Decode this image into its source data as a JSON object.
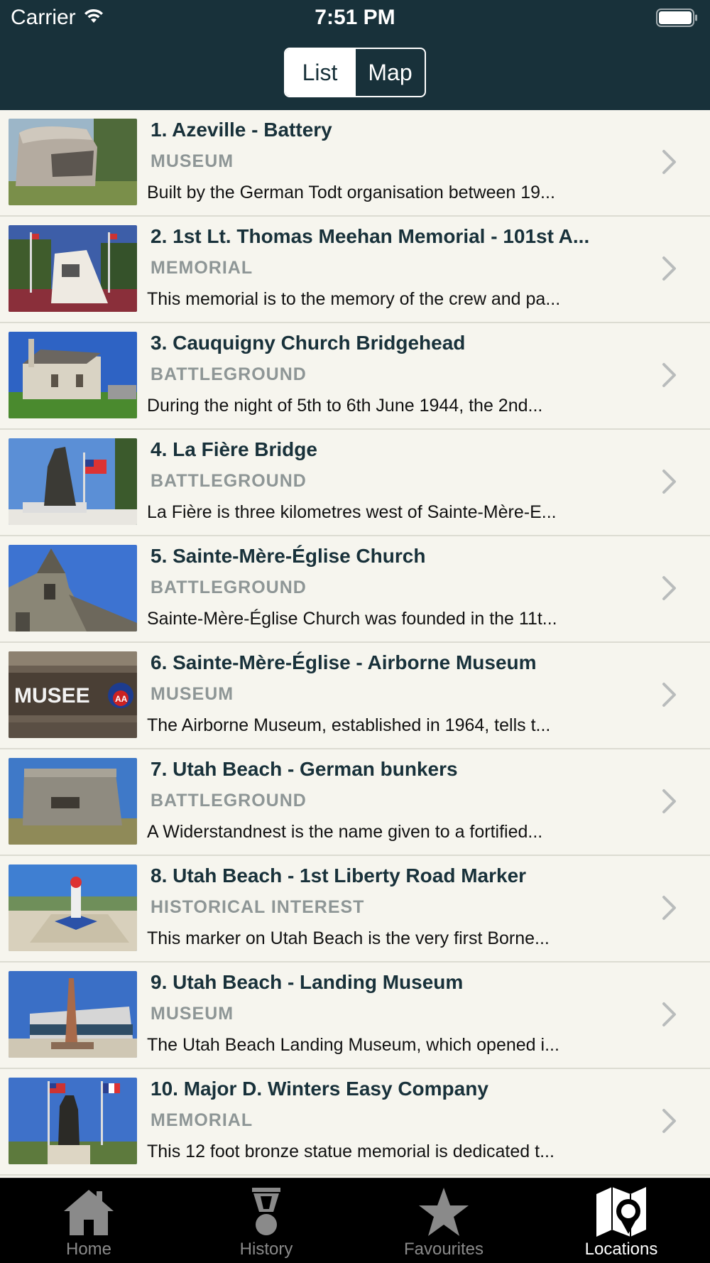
{
  "status_bar": {
    "carrier": "Carrier",
    "time": "7:51 PM"
  },
  "segmented_control": {
    "options": [
      "List",
      "Map"
    ],
    "selected": "List"
  },
  "locations": [
    {
      "title": "1. Azeville - Battery",
      "category": "MUSEUM",
      "description": "Built by the German Todt organisation between 19..."
    },
    {
      "title": "2. 1st Lt. Thomas Meehan Memorial - 101st A...",
      "category": "MEMORIAL",
      "description": "This memorial is to the memory of the crew and pa..."
    },
    {
      "title": "3. Cauquigny Church Bridgehead",
      "category": "BATTLEGROUND",
      "description": "During the night of 5th to 6th June 1944, the 2nd..."
    },
    {
      "title": "4. La Fière Bridge",
      "category": "BATTLEGROUND",
      "description": "La Fière is three kilometres west of Sainte-Mère-E..."
    },
    {
      "title": "5. Sainte-Mère-Église Church",
      "category": "BATTLEGROUND",
      "description": "Sainte-Mère-Église Church was founded in the 11t..."
    },
    {
      "title": "6. Sainte-Mère-Église - Airborne Museum",
      "category": "MUSEUM",
      "description": "The Airborne Museum, established in 1964, tells t..."
    },
    {
      "title": "7. Utah Beach - German bunkers",
      "category": "BATTLEGROUND",
      "description": "A Widerstandnest is the name given to a fortified..."
    },
    {
      "title": "8. Utah Beach - 1st Liberty Road Marker",
      "category": "HISTORICAL INTEREST",
      "description": "This marker on Utah Beach is the very first Borne..."
    },
    {
      "title": "9. Utah Beach - Landing Museum",
      "category": "MUSEUM",
      "description": "The Utah Beach Landing Museum, which opened i..."
    },
    {
      "title": "10. Major D. Winters Easy Company",
      "category": "MEMORIAL",
      "description": "This 12 foot bronze statue memorial  is dedicated t..."
    }
  ],
  "thumbnail_text": {
    "musee_sign": "MUSEE",
    "airborne_badge": "AA"
  },
  "tab_bar": {
    "tabs": [
      {
        "label": "Home",
        "icon": "home-icon"
      },
      {
        "label": "History",
        "icon": "medal-icon"
      },
      {
        "label": "Favourites",
        "icon": "star-icon"
      },
      {
        "label": "Locations",
        "icon": "map-pin-icon"
      }
    ],
    "active": "Locations"
  },
  "colors": {
    "header_bg": "#18313a",
    "title_text": "#18313a",
    "category_text": "#8e9696",
    "list_bg": "#f6f5ee",
    "tabbar_bg": "#000000"
  }
}
